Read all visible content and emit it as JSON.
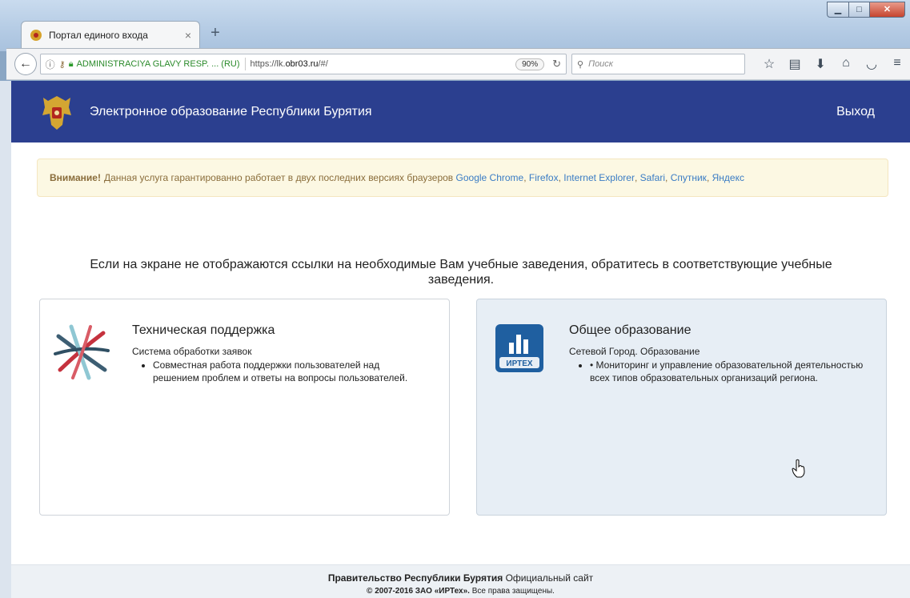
{
  "browser": {
    "tab_title": "Портал единого входа",
    "tab_close": "×",
    "new_tab": "+",
    "identity": "ADMINISTRACIYA GLAVY RESP. ... (RU)",
    "url_prefix": "https://lk.",
    "url_domain": "obr03.ru",
    "url_suffix": "/#/",
    "zoom": "90%",
    "search_placeholder": "Поиск"
  },
  "window_buttons": {
    "minimize": "▁",
    "maximize": "□",
    "close": "✕"
  },
  "header": {
    "title": "Электронное образование Республики Бурятия",
    "logout": "Выход"
  },
  "alert": {
    "lead": "Внимание!",
    "text": "Данная услуга гарантированно работает в двух последних версиях браузеров",
    "browsers": [
      "Google Chrome",
      "Firefox",
      "Internet Explorer",
      "Safari",
      "Спутник",
      "Яндекс"
    ]
  },
  "notice": "Если на экране не отображаются ссылки на необходимые Вам учебные заведения, обратитесь в соответствующие учебные заведения.",
  "cards": [
    {
      "title": "Техническая поддержка",
      "subtitle": "Система обработки заявок",
      "items": [
        "Совместная работа поддержки пользователей над решением проблем и ответы на вопросы пользователей."
      ]
    },
    {
      "title": "Общее образование",
      "subtitle": "Сетевой Город. Образование",
      "items": [
        "• Мониторинг и управление образовательной деятельностью всех типов образовательных организаций региона."
      ],
      "logo_text": "ИРТЕХ"
    }
  ],
  "footer": {
    "org": "Правительство Республики Бурятия",
    "org_suffix": "Официальный сайт",
    "copyright_prefix": "© 2007-2016 ЗАО",
    "company": "«ИРТех».",
    "copyright_suffix": "Все права защищены."
  }
}
